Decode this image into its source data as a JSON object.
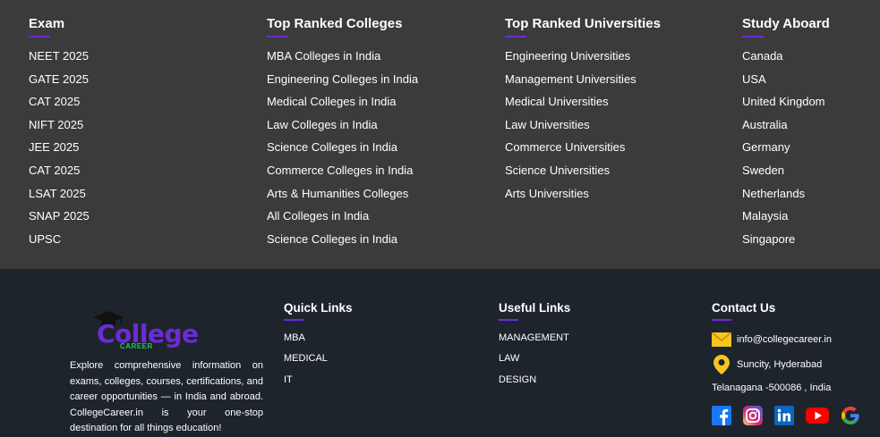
{
  "top_section": {
    "columns": [
      {
        "heading": "Exam",
        "items": [
          "NEET 2025",
          "GATE 2025",
          "CAT 2025",
          "NIFT 2025",
          "JEE 2025",
          "CAT 2025",
          "LSAT 2025",
          "SNAP 2025",
          "UPSC"
        ]
      },
      {
        "heading": "Top Ranked Colleges",
        "items": [
          "MBA Colleges in India",
          "Engineering Colleges in India",
          "Medical Colleges in India",
          "Law Colleges in India",
          "Science Colleges in India",
          "Commerce Colleges in India",
          "Arts & Humanities Colleges",
          "All Colleges in India",
          "Science Colleges in India"
        ]
      },
      {
        "heading": "Top Ranked Universities",
        "items": [
          "Engineering Universities",
          "Management Universities",
          "Medical Universities",
          "Law Universities",
          "Commerce Universities",
          "Science Universities",
          "Arts Universities"
        ]
      },
      {
        "heading": "Study Aboard",
        "items": [
          "Canada",
          "USA",
          "United Kingdom",
          "Australia",
          "Germany",
          "Sweden",
          "Netherlands",
          "Malaysia",
          "Singapore"
        ]
      }
    ]
  },
  "brand": {
    "logo_text": "College",
    "logo_sub": "CAREER",
    "description": "Explore comprehensive information on exams, colleges, courses, certifications, and career opportunities — in India and abroad. CollegeCareer.in is your one-stop destination for all things education!"
  },
  "quick_links": {
    "heading": "Quick Links",
    "items": [
      "MBA",
      "MEDICAL",
      "IT"
    ]
  },
  "useful_links": {
    "heading": "Useful Links",
    "items": [
      "MANAGEMENT",
      "LAW",
      "DESIGN"
    ]
  },
  "contact": {
    "heading": "Contact Us",
    "email": "info@collegecareer.in",
    "address_line1": "Suncity, Hyderabad",
    "address_line2": "Telanagana -500086 , India"
  },
  "socials": [
    "facebook-icon",
    "instagram-icon",
    "linkedin-icon",
    "youtube-icon",
    "google-icon"
  ],
  "colors": {
    "top_bg": "#3b3b3b",
    "bottom_bg": "#1e242b",
    "accent": "#6c2bd9"
  }
}
